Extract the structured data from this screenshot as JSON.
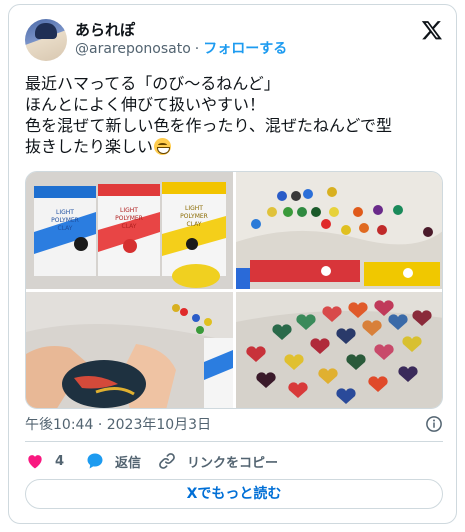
{
  "user": {
    "display_name": "あられぽ",
    "handle": "@arareponosato",
    "separator": "·",
    "follow_label": "フォローする"
  },
  "tweet": {
    "lines": [
      "最近ハマってる「のび〜るねんど」",
      "ほんとによく伸びて扱いやすい！",
      "色を混ぜて新しい色を作ったり、混ぜたねんどで型",
      "抜きしたり楽しい"
    ],
    "emoji": "grinning-face"
  },
  "media": {
    "photos": [
      {
        "name": "clay-packages-photo",
        "package_text": [
          "LIGHT",
          "POLYMER",
          "CLAY"
        ]
      },
      {
        "name": "clay-balls-photo"
      },
      {
        "name": "mixing-clay-photo"
      },
      {
        "name": "clay-hearts-photo"
      }
    ]
  },
  "meta": {
    "time": "午後10:44",
    "separator": "·",
    "date": "2023年10月3日"
  },
  "actions": {
    "like_count": "4",
    "reply_label": "返信",
    "copy_link_label": "リンクをコピー"
  },
  "read_more_label": "Xでもっと読む",
  "colors": {
    "link_blue": "#1d9bf0",
    "like_pink": "#f91880",
    "reply_blue": "#1d9bf0",
    "read_more_text": "#006fd6",
    "border": "#cfd9de",
    "muted_text": "#536471"
  }
}
